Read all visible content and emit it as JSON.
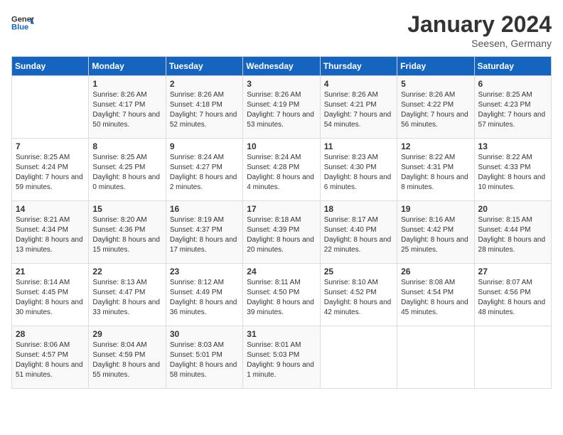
{
  "header": {
    "logo_general": "General",
    "logo_blue": "Blue",
    "month_title": "January 2024",
    "location": "Seesen, Germany"
  },
  "weekdays": [
    "Sunday",
    "Monday",
    "Tuesday",
    "Wednesday",
    "Thursday",
    "Friday",
    "Saturday"
  ],
  "weeks": [
    [
      {
        "day": "",
        "sunrise": "",
        "sunset": "",
        "daylight": ""
      },
      {
        "day": "1",
        "sunrise": "Sunrise: 8:26 AM",
        "sunset": "Sunset: 4:17 PM",
        "daylight": "Daylight: 7 hours and 50 minutes."
      },
      {
        "day": "2",
        "sunrise": "Sunrise: 8:26 AM",
        "sunset": "Sunset: 4:18 PM",
        "daylight": "Daylight: 7 hours and 52 minutes."
      },
      {
        "day": "3",
        "sunrise": "Sunrise: 8:26 AM",
        "sunset": "Sunset: 4:19 PM",
        "daylight": "Daylight: 7 hours and 53 minutes."
      },
      {
        "day": "4",
        "sunrise": "Sunrise: 8:26 AM",
        "sunset": "Sunset: 4:21 PM",
        "daylight": "Daylight: 7 hours and 54 minutes."
      },
      {
        "day": "5",
        "sunrise": "Sunrise: 8:26 AM",
        "sunset": "Sunset: 4:22 PM",
        "daylight": "Daylight: 7 hours and 56 minutes."
      },
      {
        "day": "6",
        "sunrise": "Sunrise: 8:25 AM",
        "sunset": "Sunset: 4:23 PM",
        "daylight": "Daylight: 7 hours and 57 minutes."
      }
    ],
    [
      {
        "day": "7",
        "sunrise": "Sunrise: 8:25 AM",
        "sunset": "Sunset: 4:24 PM",
        "daylight": "Daylight: 7 hours and 59 minutes."
      },
      {
        "day": "8",
        "sunrise": "Sunrise: 8:25 AM",
        "sunset": "Sunset: 4:25 PM",
        "daylight": "Daylight: 8 hours and 0 minutes."
      },
      {
        "day": "9",
        "sunrise": "Sunrise: 8:24 AM",
        "sunset": "Sunset: 4:27 PM",
        "daylight": "Daylight: 8 hours and 2 minutes."
      },
      {
        "day": "10",
        "sunrise": "Sunrise: 8:24 AM",
        "sunset": "Sunset: 4:28 PM",
        "daylight": "Daylight: 8 hours and 4 minutes."
      },
      {
        "day": "11",
        "sunrise": "Sunrise: 8:23 AM",
        "sunset": "Sunset: 4:30 PM",
        "daylight": "Daylight: 8 hours and 6 minutes."
      },
      {
        "day": "12",
        "sunrise": "Sunrise: 8:22 AM",
        "sunset": "Sunset: 4:31 PM",
        "daylight": "Daylight: 8 hours and 8 minutes."
      },
      {
        "day": "13",
        "sunrise": "Sunrise: 8:22 AM",
        "sunset": "Sunset: 4:33 PM",
        "daylight": "Daylight: 8 hours and 10 minutes."
      }
    ],
    [
      {
        "day": "14",
        "sunrise": "Sunrise: 8:21 AM",
        "sunset": "Sunset: 4:34 PM",
        "daylight": "Daylight: 8 hours and 13 minutes."
      },
      {
        "day": "15",
        "sunrise": "Sunrise: 8:20 AM",
        "sunset": "Sunset: 4:36 PM",
        "daylight": "Daylight: 8 hours and 15 minutes."
      },
      {
        "day": "16",
        "sunrise": "Sunrise: 8:19 AM",
        "sunset": "Sunset: 4:37 PM",
        "daylight": "Daylight: 8 hours and 17 minutes."
      },
      {
        "day": "17",
        "sunrise": "Sunrise: 8:18 AM",
        "sunset": "Sunset: 4:39 PM",
        "daylight": "Daylight: 8 hours and 20 minutes."
      },
      {
        "day": "18",
        "sunrise": "Sunrise: 8:17 AM",
        "sunset": "Sunset: 4:40 PM",
        "daylight": "Daylight: 8 hours and 22 minutes."
      },
      {
        "day": "19",
        "sunrise": "Sunrise: 8:16 AM",
        "sunset": "Sunset: 4:42 PM",
        "daylight": "Daylight: 8 hours and 25 minutes."
      },
      {
        "day": "20",
        "sunrise": "Sunrise: 8:15 AM",
        "sunset": "Sunset: 4:44 PM",
        "daylight": "Daylight: 8 hours and 28 minutes."
      }
    ],
    [
      {
        "day": "21",
        "sunrise": "Sunrise: 8:14 AM",
        "sunset": "Sunset: 4:45 PM",
        "daylight": "Daylight: 8 hours and 30 minutes."
      },
      {
        "day": "22",
        "sunrise": "Sunrise: 8:13 AM",
        "sunset": "Sunset: 4:47 PM",
        "daylight": "Daylight: 8 hours and 33 minutes."
      },
      {
        "day": "23",
        "sunrise": "Sunrise: 8:12 AM",
        "sunset": "Sunset: 4:49 PM",
        "daylight": "Daylight: 8 hours and 36 minutes."
      },
      {
        "day": "24",
        "sunrise": "Sunrise: 8:11 AM",
        "sunset": "Sunset: 4:50 PM",
        "daylight": "Daylight: 8 hours and 39 minutes."
      },
      {
        "day": "25",
        "sunrise": "Sunrise: 8:10 AM",
        "sunset": "Sunset: 4:52 PM",
        "daylight": "Daylight: 8 hours and 42 minutes."
      },
      {
        "day": "26",
        "sunrise": "Sunrise: 8:08 AM",
        "sunset": "Sunset: 4:54 PM",
        "daylight": "Daylight: 8 hours and 45 minutes."
      },
      {
        "day": "27",
        "sunrise": "Sunrise: 8:07 AM",
        "sunset": "Sunset: 4:56 PM",
        "daylight": "Daylight: 8 hours and 48 minutes."
      }
    ],
    [
      {
        "day": "28",
        "sunrise": "Sunrise: 8:06 AM",
        "sunset": "Sunset: 4:57 PM",
        "daylight": "Daylight: 8 hours and 51 minutes."
      },
      {
        "day": "29",
        "sunrise": "Sunrise: 8:04 AM",
        "sunset": "Sunset: 4:59 PM",
        "daylight": "Daylight: 8 hours and 55 minutes."
      },
      {
        "day": "30",
        "sunrise": "Sunrise: 8:03 AM",
        "sunset": "Sunset: 5:01 PM",
        "daylight": "Daylight: 8 hours and 58 minutes."
      },
      {
        "day": "31",
        "sunrise": "Sunrise: 8:01 AM",
        "sunset": "Sunset: 5:03 PM",
        "daylight": "Daylight: 9 hours and 1 minute."
      },
      {
        "day": "",
        "sunrise": "",
        "sunset": "",
        "daylight": ""
      },
      {
        "day": "",
        "sunrise": "",
        "sunset": "",
        "daylight": ""
      },
      {
        "day": "",
        "sunrise": "",
        "sunset": "",
        "daylight": ""
      }
    ]
  ]
}
